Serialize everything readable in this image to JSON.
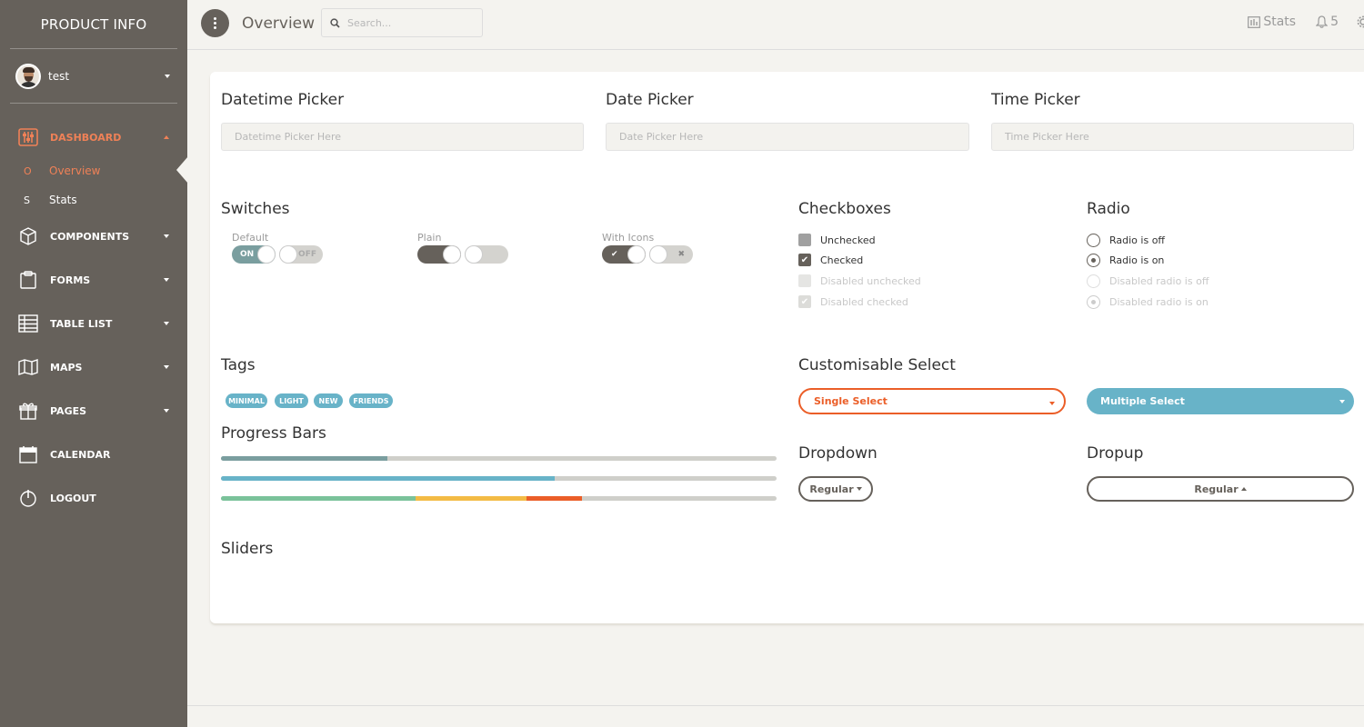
{
  "colors": {
    "sidebar_bg": "#66615b",
    "accent": "#ef8157",
    "info": "#68b3c8",
    "success": "#7ac29a",
    "warning": "#f3bb45",
    "danger": "#eb5e28"
  },
  "sidebar": {
    "brand": "PRODUCT INFO",
    "user_name": "test",
    "items": [
      {
        "label": "DASHBOARD",
        "icon": "sliders-icon",
        "active": true
      },
      {
        "label": "COMPONENTS",
        "icon": "cube-icon"
      },
      {
        "label": "FORMS",
        "icon": "clipboard-icon"
      },
      {
        "label": "TABLE LIST",
        "icon": "table-icon"
      },
      {
        "label": "MAPS",
        "icon": "map-icon"
      },
      {
        "label": "PAGES",
        "icon": "gift-icon"
      },
      {
        "label": "CALENDAR",
        "icon": "calendar-icon"
      },
      {
        "label": "LOGOUT",
        "icon": "power-icon"
      }
    ],
    "dashboard_sub": [
      {
        "mini": "O",
        "label": "Overview",
        "active": true
      },
      {
        "mini": "S",
        "label": "Stats"
      }
    ]
  },
  "topbar": {
    "title": "Overview",
    "search_placeholder": "Search...",
    "stats_label": "Stats",
    "notifications_count": "5"
  },
  "pickers": {
    "datetime": {
      "title": "Datetime Picker",
      "placeholder": "Datetime Picker Here"
    },
    "date": {
      "title": "Date Picker",
      "placeholder": "Date Picker Here"
    },
    "time": {
      "title": "Time Picker",
      "placeholder": "Time Picker Here"
    }
  },
  "switches": {
    "title": "Switches",
    "default_label": "Default",
    "plain_label": "Plain",
    "icons_label": "With Icons",
    "on_text": "ON",
    "off_text": "OFF",
    "check_glyph": "✔",
    "x_glyph": "✖"
  },
  "checkboxes": {
    "title": "Checkboxes",
    "items": [
      "Unchecked",
      "Checked",
      "Disabled unchecked",
      "Disabled checked"
    ]
  },
  "radio": {
    "title": "Radio",
    "items": [
      "Radio is off",
      "Radio is on",
      "Disabled radio is off",
      "Disabled radio is on"
    ]
  },
  "tags": {
    "title": "Tags",
    "items": [
      "MINIMAL",
      "LIGHT",
      "NEW",
      "FRIENDS"
    ]
  },
  "progress": {
    "title": "Progress Bars",
    "bars": [
      {
        "segments": [
          {
            "percent": 30,
            "color": "#7a9e9f"
          }
        ]
      },
      {
        "segments": [
          {
            "percent": 60,
            "color": "#68b3c8"
          }
        ]
      },
      {
        "segments": [
          {
            "percent": 35,
            "color": "#7ac29a"
          },
          {
            "percent": 20,
            "color": "#f3bb45"
          },
          {
            "percent": 10,
            "color": "#eb5e28"
          }
        ]
      }
    ]
  },
  "selects": {
    "title": "Customisable Select",
    "single": "Single Select",
    "multiple": "Multiple Select"
  },
  "dropdown": {
    "title": "Dropdown",
    "label": "Regular"
  },
  "dropup": {
    "title": "Dropup",
    "label": "Regular"
  },
  "sliders": {
    "title": "Sliders"
  }
}
